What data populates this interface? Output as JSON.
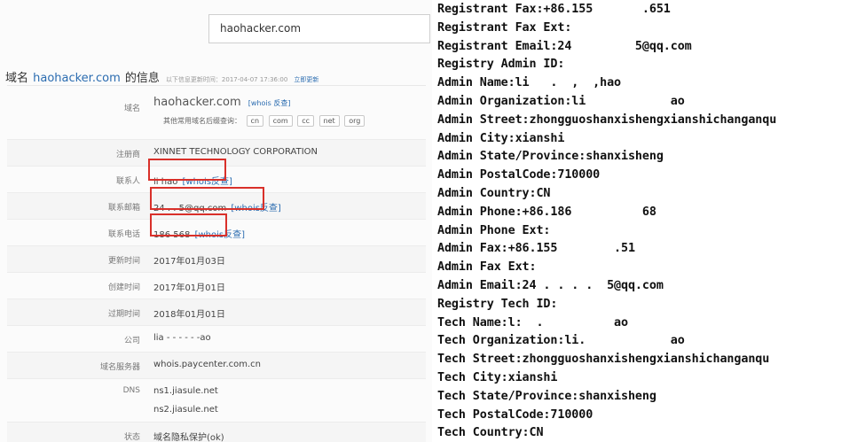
{
  "search": {
    "value": "haohacker.com"
  },
  "info_header": {
    "domain_label": "域名",
    "domain": "haohacker.com",
    "suffix": "的信息",
    "updated": "以下信息更新时间：2017-04-07 17:36:00",
    "refresh_link": "立即更新"
  },
  "rows": {
    "domain": {
      "label": "域名",
      "value": "haohacker.com",
      "whois": "[whois 反查]",
      "suffix_hint": "其他常用域名后缀查询：",
      "suffixes": [
        "cn",
        "com",
        "cc",
        "net",
        "org"
      ]
    },
    "registrar": {
      "label": "注册商",
      "value": "XINNET TECHNOLOGY CORPORATION"
    },
    "contact": {
      "label": "联系人",
      "value": "li      hao",
      "whois": "[whois反查]"
    },
    "email": {
      "label": "联系邮箱",
      "value": "24 . .    5@qq.com",
      "whois": "[whois反查]"
    },
    "phone": {
      "label": "联系电话",
      "value": "186        568",
      "whois": "[whois反查]"
    },
    "updated": {
      "label": "更新时间",
      "value": "2017年01月03日"
    },
    "created": {
      "label": "创建时间",
      "value": "2017年01月01日"
    },
    "expires": {
      "label": "过期时间",
      "value": "2018年01月01日"
    },
    "company": {
      "label": "公司",
      "value": "lia - - - - - -ao"
    },
    "dns_server": {
      "label": "域名服务器",
      "value": "whois.paycenter.com.cn"
    },
    "dns": {
      "label": "DNS",
      "values": [
        "ns1.jiasule.net",
        "ns2.jiasule.net"
      ]
    },
    "status": {
      "label": "状态",
      "value": "域名隐私保护(ok)"
    }
  },
  "terminal": [
    "Registrant Fax:+86.155       .651",
    "Registrant Fax Ext:",
    "Registrant Email:24         5@qq.com",
    "Registry Admin ID:",
    "Admin Name:li   .  ,  ,hao",
    "Admin Organization:li            ao",
    "Admin Street:zhongguoshanxishengxianshichanganqu",
    "Admin City:xianshi",
    "Admin State/Province:shanxisheng",
    "Admin PostalCode:710000",
    "Admin Country:CN",
    "Admin Phone:+86.186          68",
    "Admin Phone Ext:",
    "Admin Fax:+86.155        .51",
    "Admin Fax Ext:",
    "Admin Email:24 . . . .  5@qq.com",
    "Registry Tech ID:",
    "Tech Name:l:  .          ao",
    "Tech Organization:li.            ao",
    "Tech Street:zhongguoshanxishengxianshichanganqu",
    "Tech City:xianshi",
    "Tech State/Province:shanxisheng",
    "Tech PostalCode:710000",
    "Tech Country:CN"
  ]
}
